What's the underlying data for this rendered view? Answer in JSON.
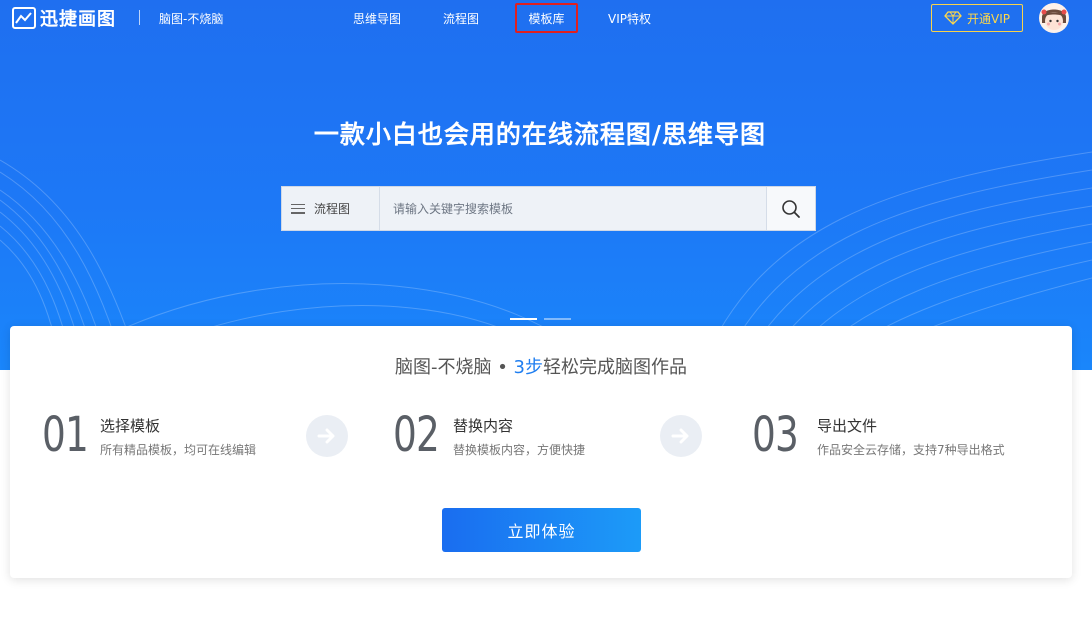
{
  "brand": {
    "name": "迅捷画图",
    "slogan": "脑图-不烧脑"
  },
  "nav": {
    "items": [
      {
        "label": "思维导图"
      },
      {
        "label": "流程图"
      },
      {
        "label": "模板库"
      },
      {
        "label": "VIP特权"
      }
    ],
    "active_item": "模板库",
    "vip_button": "开通VIP"
  },
  "hero": {
    "title": "一款小白也会用的在线流程图/思维导图",
    "search": {
      "category": "流程图",
      "placeholder": "请输入关键字搜索模板",
      "value": ""
    }
  },
  "steps_card": {
    "title_prefix": "脑图-不烧脑 • ",
    "title_highlight": "3步",
    "title_suffix": "轻松完成脑图作品",
    "steps": [
      {
        "num": "01",
        "title": "选择模板",
        "desc": "所有精品模板，均可在线编辑"
      },
      {
        "num": "02",
        "title": "替换内容",
        "desc": "替换模板内容，方便快捷"
      },
      {
        "num": "03",
        "title": "导出文件",
        "desc": "作品安全云存储，支持7种导出格式"
      }
    ],
    "cta": "立即体验"
  },
  "colors": {
    "hero_blue": "#1d78f6",
    "accent": "#1f7ef0",
    "vip_gold": "#ffd84a",
    "active_border": "#e02020"
  }
}
